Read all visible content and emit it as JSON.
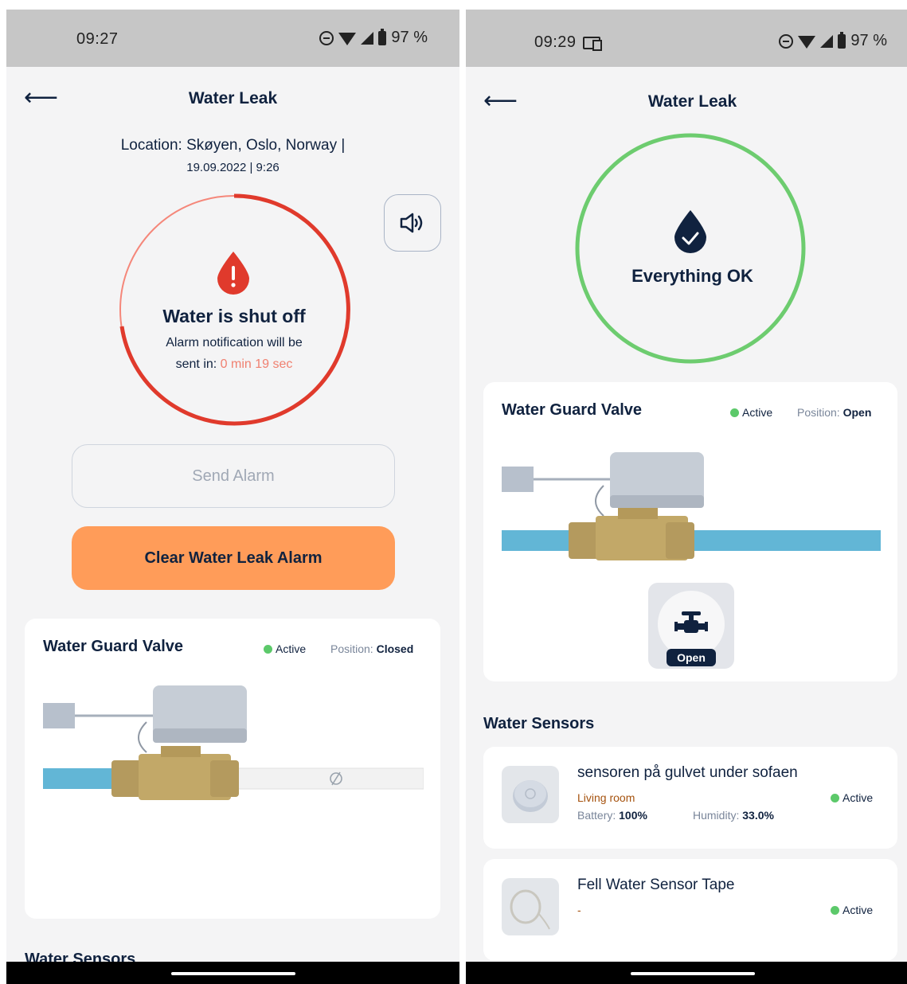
{
  "left_screen": {
    "statusbar": {
      "time": "09:27",
      "battery": "97 %"
    },
    "header": {
      "back_icon": "arrow-left-icon",
      "title": "Water Leak"
    },
    "location": "Location: Skøyen, Oslo, Norway |",
    "datetime": "19.09.2022 | 9:26",
    "alarm": {
      "icon": "water-drop-alert-icon",
      "title": "Water is shut off",
      "line1": "Alarm notification will be",
      "line2_prefix": "sent in: ",
      "countdown": "0 min 19 sec",
      "ring_color": "#e03a2c"
    },
    "speaker_icon": "speaker-icon",
    "send_alarm_label": "Send Alarm",
    "clear_alarm_label": "Clear Water Leak Alarm",
    "valve_card": {
      "title": "Water Guard Valve",
      "status": "Active",
      "position_label": "Position:",
      "position_value": "Closed"
    },
    "section_sensors": "Water Sensors"
  },
  "right_screen": {
    "statusbar": {
      "time": "09:29",
      "battery": "97 %"
    },
    "header": {
      "back_icon": "arrow-left-icon",
      "title": "Water Leak"
    },
    "ok": {
      "icon": "water-drop-check-icon",
      "label": "Everything OK",
      "ring_color": "#6dcc6f"
    },
    "valve_card": {
      "title": "Water Guard Valve",
      "status": "Active",
      "position_label": "Position:",
      "position_value": "Open",
      "toggle_icon": "valve-icon",
      "toggle_label": "Open"
    },
    "section_sensors": "Water Sensors",
    "sensors": [
      {
        "name": "sensoren på gulvet under sofaen",
        "room": "Living room",
        "status": "Active",
        "battery_label": "Battery:",
        "battery_value": "100%",
        "humidity_label": "Humidity:",
        "humidity_value": "33.0%"
      },
      {
        "name": "Fell Water Sensor Tape",
        "room": "-",
        "status": "Active"
      }
    ]
  }
}
